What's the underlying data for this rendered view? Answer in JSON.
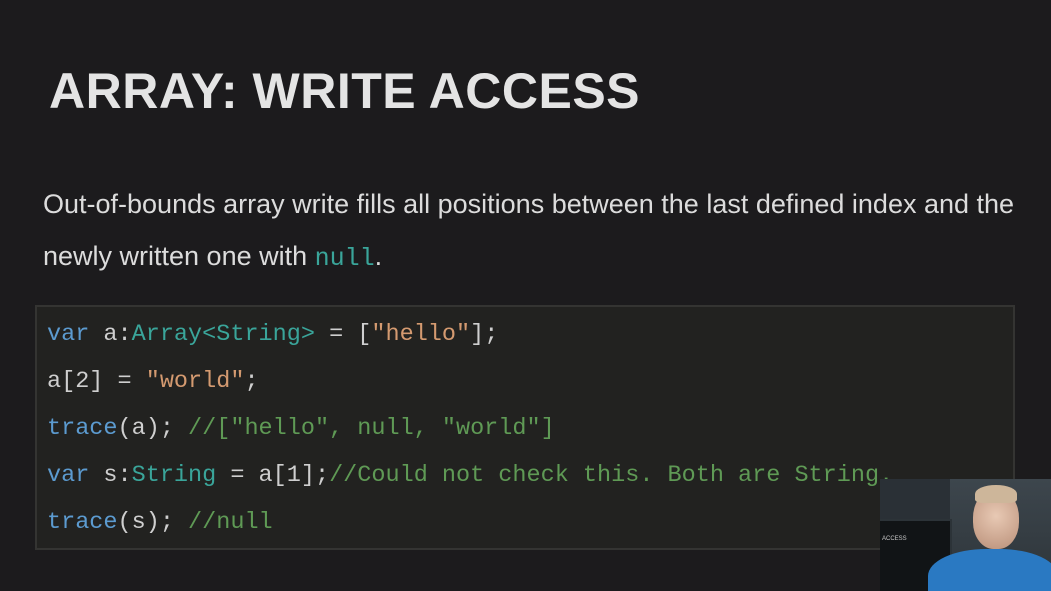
{
  "slide": {
    "title": "ARRAY: WRITE ACCESS",
    "description_before": "Out-of-bounds array write fills all positions between the last defined index and the newly written one with ",
    "description_code": "null",
    "description_after": "."
  },
  "code": {
    "line1": {
      "kw": "var",
      "sp1": " a:",
      "type": "Array<String>",
      "rest": " = [",
      "str": "\"hello\"",
      "end": "];"
    },
    "line2": {
      "pre": "a[2] = ",
      "str": "\"world\"",
      "end": ";"
    },
    "line3": {
      "fn": "trace",
      "args": "(a); ",
      "comment": "//[\"hello\", null, \"world\"]"
    },
    "line4": {
      "kw": "var",
      "sp1": " s:",
      "type": "String",
      "rest": " = a[1];",
      "comment": "//Could not check this. Both are String."
    },
    "line5": {
      "fn": "trace",
      "args": "(s); ",
      "comment": "//null"
    }
  },
  "webcam": {
    "monitor_text": "ACCESS"
  }
}
